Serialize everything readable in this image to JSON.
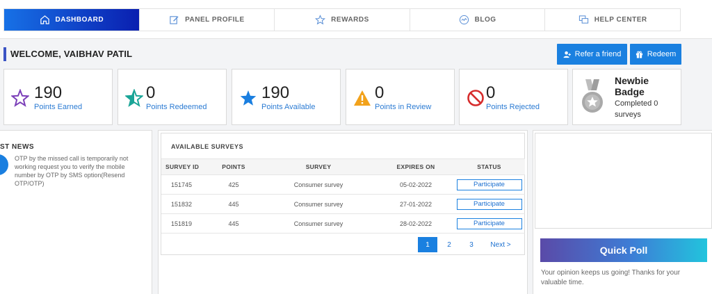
{
  "nav": {
    "items": [
      {
        "label": "DASHBOARD",
        "icon": "home-icon"
      },
      {
        "label": "PANEL PROFILE",
        "icon": "edit-icon"
      },
      {
        "label": "REWARDS",
        "icon": "star-icon"
      },
      {
        "label": "BLOG",
        "icon": "blog-icon"
      },
      {
        "label": "HELP CENTER",
        "icon": "chat-icon"
      }
    ],
    "active_color": "#1771e6"
  },
  "welcome": {
    "text": "WELCOME, VAIBHAV PATIL"
  },
  "actions": {
    "refer": "Refer a friend",
    "redeem": "Redeem"
  },
  "stats": [
    {
      "value": "190",
      "label": "Points Earned",
      "icon": "star-outline-icon",
      "color": "#7b3fb8"
    },
    {
      "value": "0",
      "label": "Points Redeemed",
      "icon": "star-half-icon",
      "color": "#1aa597"
    },
    {
      "value": "190",
      "label": "Points Available",
      "icon": "star-filled-icon",
      "color": "#1a7fe0"
    },
    {
      "value": "0",
      "label": "Points in Review",
      "icon": "warning-icon",
      "color": "#f2a21b"
    },
    {
      "value": "0",
      "label": "Points Rejected",
      "icon": "blocked-icon",
      "color": "#d62c2c"
    }
  ],
  "badge": {
    "title": "Newbie Badge",
    "subtitle": "Completed 0 surveys",
    "icon": "medal-icon"
  },
  "news": {
    "title": "ST NEWS",
    "text": "OTP by the missed call is temporarily not working request you to verify the mobile number by OTP by SMS option(Resend OTP/OTP)"
  },
  "surveys": {
    "heading": "AVAILABLE SURVEYS",
    "columns": [
      "SURVEY ID",
      "POINTS",
      "SURVEY",
      "EXPIRES ON",
      "STATUS"
    ],
    "rows": [
      {
        "id": "151745",
        "points": "425",
        "survey": "Consumer survey",
        "expires": "05-02-2022",
        "status": "Participate"
      },
      {
        "id": "151832",
        "points": "445",
        "survey": "Consumer survey",
        "expires": "27-01-2022",
        "status": "Participate"
      },
      {
        "id": "151819",
        "points": "445",
        "survey": "Consumer survey",
        "expires": "28-02-2022",
        "status": "Participate"
      }
    ],
    "pagination": {
      "pages": [
        "1",
        "2",
        "3"
      ],
      "current": "1",
      "next": "Next >"
    }
  },
  "poll": {
    "button": "Quick Poll",
    "text": "Your opinion keeps us going! Thanks for your valuable time."
  }
}
